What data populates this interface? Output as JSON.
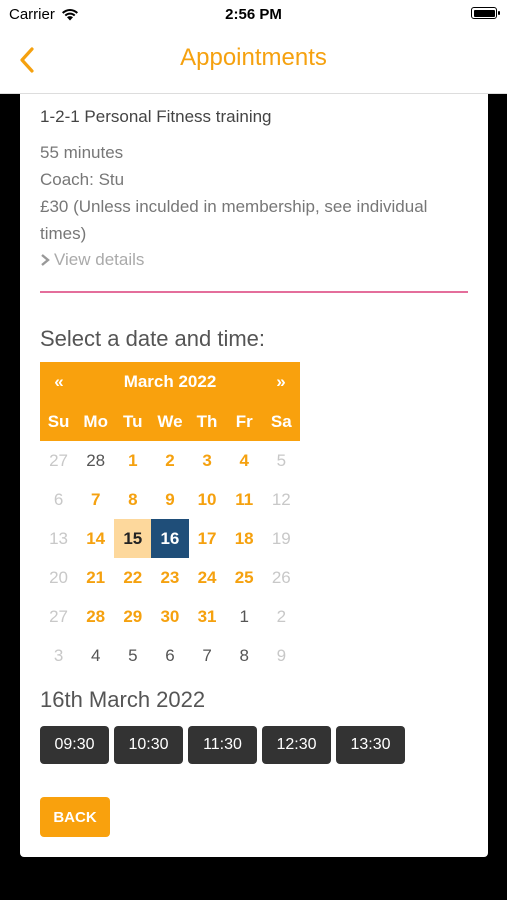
{
  "status": {
    "carrier": "Carrier",
    "time": "2:56 PM"
  },
  "nav": {
    "title": "Appointments"
  },
  "service": {
    "name": "1-2-1 Personal Fitness training",
    "duration": "55 minutes",
    "coach": "Coach: Stu",
    "price_line1": "£30 (Unless inculded in membership, see individual",
    "price_line2": "times)",
    "details_link": "View details"
  },
  "select_heading": "Select a date and time:",
  "calendar": {
    "prev": "«",
    "next": "»",
    "month": "March 2022",
    "weekdays": [
      "Su",
      "Mo",
      "Tu",
      "We",
      "Th",
      "Fr",
      "Sa"
    ],
    "weeks": [
      [
        {
          "d": "27",
          "s": "other"
        },
        {
          "d": "28",
          "s": "plain"
        },
        {
          "d": "1",
          "s": "avail"
        },
        {
          "d": "2",
          "s": "avail"
        },
        {
          "d": "3",
          "s": "avail"
        },
        {
          "d": "4",
          "s": "avail"
        },
        {
          "d": "5",
          "s": "other"
        }
      ],
      [
        {
          "d": "6",
          "s": "other"
        },
        {
          "d": "7",
          "s": "avail"
        },
        {
          "d": "8",
          "s": "avail"
        },
        {
          "d": "9",
          "s": "avail"
        },
        {
          "d": "10",
          "s": "avail"
        },
        {
          "d": "11",
          "s": "avail"
        },
        {
          "d": "12",
          "s": "other"
        }
      ],
      [
        {
          "d": "13",
          "s": "other"
        },
        {
          "d": "14",
          "s": "avail"
        },
        {
          "d": "15",
          "s": "today"
        },
        {
          "d": "16",
          "s": "selected"
        },
        {
          "d": "17",
          "s": "avail"
        },
        {
          "d": "18",
          "s": "avail"
        },
        {
          "d": "19",
          "s": "other"
        }
      ],
      [
        {
          "d": "20",
          "s": "other"
        },
        {
          "d": "21",
          "s": "avail"
        },
        {
          "d": "22",
          "s": "avail"
        },
        {
          "d": "23",
          "s": "avail"
        },
        {
          "d": "24",
          "s": "avail"
        },
        {
          "d": "25",
          "s": "avail"
        },
        {
          "d": "26",
          "s": "other"
        }
      ],
      [
        {
          "d": "27",
          "s": "other"
        },
        {
          "d": "28",
          "s": "avail"
        },
        {
          "d": "29",
          "s": "avail"
        },
        {
          "d": "30",
          "s": "avail"
        },
        {
          "d": "31",
          "s": "avail"
        },
        {
          "d": "1",
          "s": "plain"
        },
        {
          "d": "2",
          "s": "other"
        }
      ],
      [
        {
          "d": "3",
          "s": "other"
        },
        {
          "d": "4",
          "s": "plain"
        },
        {
          "d": "5",
          "s": "plain"
        },
        {
          "d": "6",
          "s": "plain"
        },
        {
          "d": "7",
          "s": "plain"
        },
        {
          "d": "8",
          "s": "plain"
        },
        {
          "d": "9",
          "s": "other"
        }
      ]
    ]
  },
  "selected_date": "16th March 2022",
  "times": [
    "09:30",
    "10:30",
    "11:30",
    "12:30",
    "13:30"
  ],
  "back_label": "BACK",
  "colors": {
    "accent": "#f9a10d",
    "selected": "#1f4e79",
    "today": "#fdd89c",
    "divider": "#e46e9b"
  }
}
